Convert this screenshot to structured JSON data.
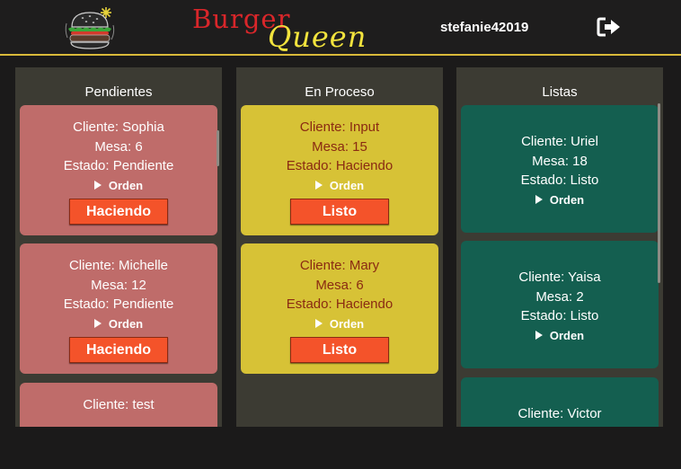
{
  "header": {
    "brand_word_1": "Burger",
    "brand_word_2": "Queen",
    "username": "stefanie42019",
    "logo_icon": "burger-crown-icon",
    "logout_icon": "logout-arrow-icon"
  },
  "colors": {
    "pendiente_card": "#bf6c6a",
    "proceso_card": "#d7c236",
    "listo_card": "#145f50",
    "action_button": "#f4532a",
    "header_rule": "#d9b93a"
  },
  "columns": [
    {
      "title": "Pendientes",
      "cards": [
        {
          "cliente": "Cliente: Sophia",
          "mesa": "Mesa: 6",
          "estado": "Estado: Pendiente",
          "orden": "Orden",
          "button": "Haciendo"
        },
        {
          "cliente": "Cliente: Michelle",
          "mesa": "Mesa: 12",
          "estado": "Estado: Pendiente",
          "orden": "Orden",
          "button": "Haciendo"
        },
        {
          "cliente": "Cliente: test"
        }
      ]
    },
    {
      "title": "En Proceso",
      "cards": [
        {
          "cliente": "Cliente: Input",
          "mesa": "Mesa: 15",
          "estado": "Estado: Haciendo",
          "orden": "Orden",
          "button": "Listo"
        },
        {
          "cliente": "Cliente: Mary",
          "mesa": "Mesa: 6",
          "estado": "Estado: Haciendo",
          "orden": "Orden",
          "button": "Listo"
        }
      ]
    },
    {
      "title": "Listas",
      "cards": [
        {
          "cliente": "Cliente: Uriel",
          "mesa": "Mesa: 18",
          "estado": "Estado: Listo",
          "orden": "Orden"
        },
        {
          "cliente": "Cliente: Yaisa",
          "mesa": "Mesa: 2",
          "estado": "Estado: Listo",
          "orden": "Orden"
        },
        {
          "cliente": "Cliente: Victor"
        }
      ]
    }
  ]
}
